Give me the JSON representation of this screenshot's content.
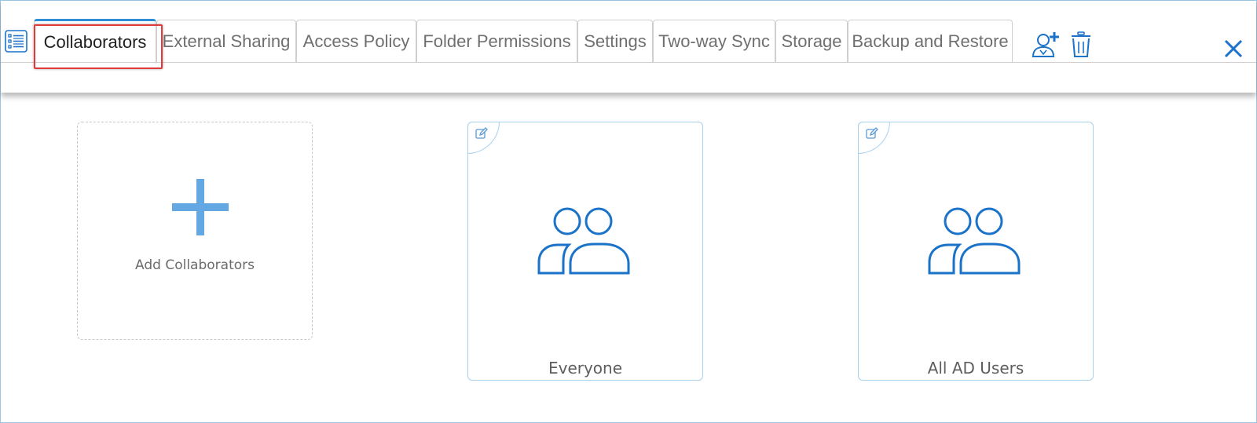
{
  "tabs": [
    {
      "label": "Collaborators",
      "active": true
    },
    {
      "label": "External Sharing",
      "active": false
    },
    {
      "label": "Access Policy",
      "active": false
    },
    {
      "label": "Folder Permissions",
      "active": false
    },
    {
      "label": "Settings",
      "active": false
    },
    {
      "label": "Two-way Sync",
      "active": false
    },
    {
      "label": "Storage",
      "active": false
    },
    {
      "label": "Backup and Restore",
      "active": false
    }
  ],
  "toolbar": {
    "list_icon": "list-view-icon",
    "add_user_icon": "add-user-icon",
    "delete_icon": "trash-icon",
    "close_icon": "close-icon"
  },
  "cards": {
    "add": {
      "label": "Add Collaborators",
      "icon": "plus-icon"
    },
    "groups": [
      {
        "label": "Everyone",
        "icon": "user-group-icon",
        "edit_icon": "edit-icon"
      },
      {
        "label": "All AD Users",
        "icon": "user-group-icon",
        "edit_icon": "edit-icon"
      }
    ]
  },
  "colors": {
    "accent": "#2f8dd6",
    "icon_blue": "#1a72c9",
    "plus_blue": "#63a8e3",
    "highlight_red": "#e03a3a",
    "border_light_blue": "#a9d1ee"
  }
}
